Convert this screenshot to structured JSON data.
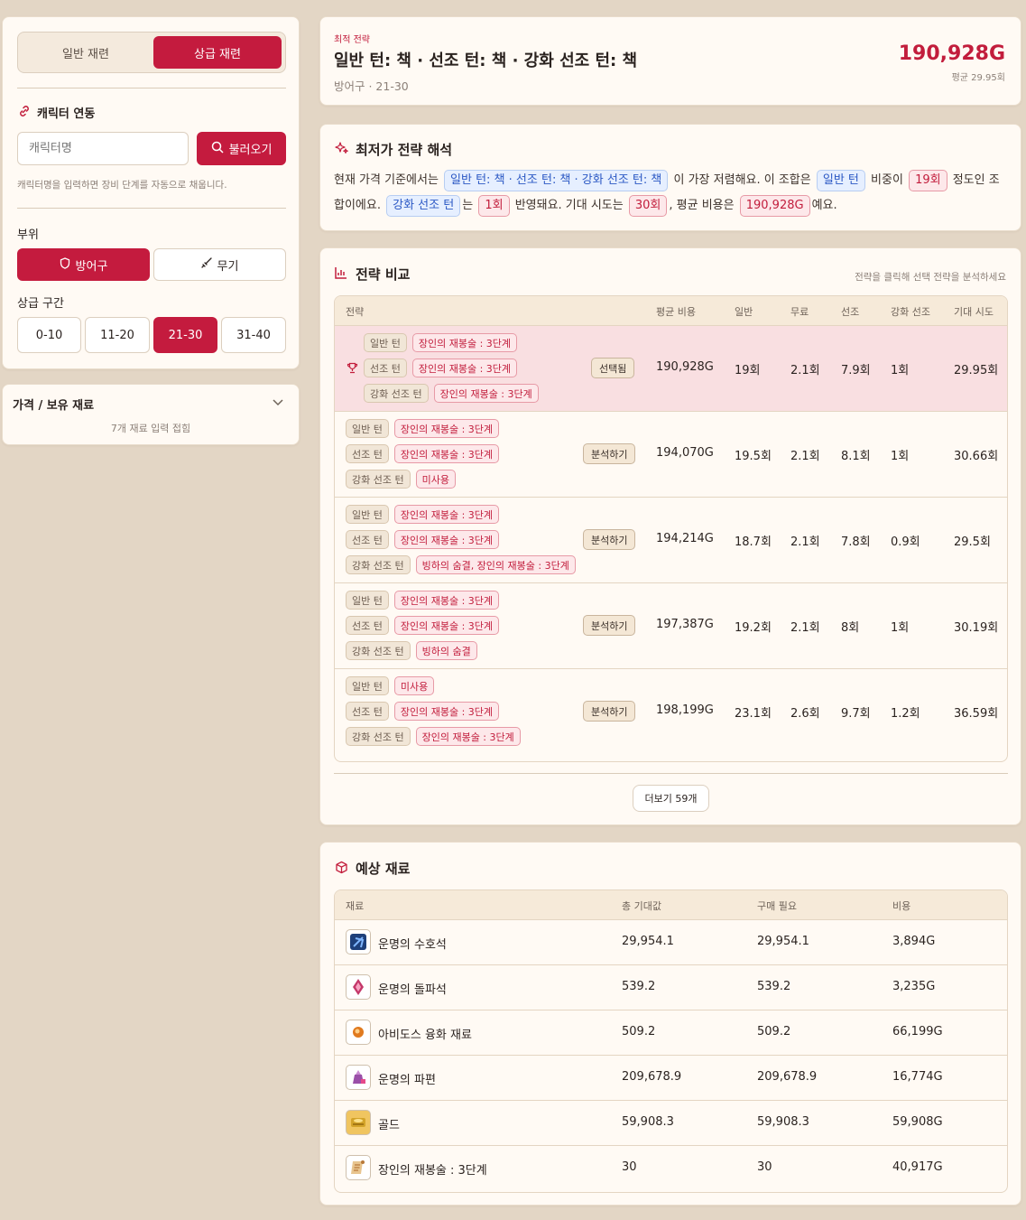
{
  "sidebar": {
    "tabs": [
      "일반 재련",
      "상급 재련"
    ],
    "character_title": "캐릭터 연동",
    "character_placeholder": "캐릭터명",
    "load_button": "불러오기",
    "character_help": "캐릭터명을 입력하면 장비 단계를 자동으로 채웁니다.",
    "part_label": "부위",
    "part_armor": "방어구",
    "part_weapon": "무기",
    "range_label": "상급 구간",
    "ranges": [
      "0-10",
      "11-20",
      "21-30",
      "31-40"
    ],
    "price_title": "가격 / 보유 재료",
    "price_sub": "7개 재료 입력 접힘"
  },
  "summary": {
    "eyebrow": "최적 전략",
    "title": "일반 턴: 책 · 선조 턴: 책 · 강화 선조 턴: 책",
    "sub": "방어구 · 21-30",
    "price": "190,928G",
    "avg": "평균 29.95회"
  },
  "analysis": {
    "title": "최저가 전략 해석",
    "t1": "현재 가격 기준에서는",
    "h1": "일반 턴: 책 · 선조 턴: 책 · 강화 선조 턴: 책",
    "t2": "이 가장 저렴해요. 이 조합은",
    "h2": "일반 턴",
    "t3": "비중이",
    "h3": "19회",
    "t4": "정도인 조합이에요.",
    "h4": "강화 선조 턴",
    "t5": "는",
    "h5": "1회",
    "t6": "반영돼요. 기대 시도는",
    "h6": "30회",
    "t7": ", 평균 비용은",
    "h7": "190,928G",
    "t8": "예요."
  },
  "compare": {
    "title": "전략 비교",
    "hint": "전략을 클릭해 선택 전략을 분석하세요",
    "headers": [
      "전략",
      "평균 비용",
      "일반",
      "무료",
      "선조",
      "강화 선조",
      "기대 시도"
    ],
    "turn_labels": [
      "일반 턴",
      "선조 턴",
      "강화 선조 턴"
    ],
    "rows": [
      {
        "tags": [
          "장인의 재봉술 : 3단계",
          "장인의 재봉술 : 3단계",
          "장인의 재봉술 : 3단계"
        ],
        "action": "선택됨",
        "cost": "190,928G",
        "normal": "19회",
        "free": "2.1회",
        "ancestor": "7.9회",
        "enh": "1회",
        "expected": "29.95회"
      },
      {
        "tags": [
          "장인의 재봉술 : 3단계",
          "장인의 재봉술 : 3단계",
          "미사용"
        ],
        "action": "분석하기",
        "cost": "194,070G",
        "normal": "19.5회",
        "free": "2.1회",
        "ancestor": "8.1회",
        "enh": "1회",
        "expected": "30.66회"
      },
      {
        "tags": [
          "장인의 재봉술 : 3단계",
          "장인의 재봉술 : 3단계",
          "빙하의 숨결, 장인의 재봉술 : 3단계"
        ],
        "action": "분석하기",
        "cost": "194,214G",
        "normal": "18.7회",
        "free": "2.1회",
        "ancestor": "7.8회",
        "enh": "0.9회",
        "expected": "29.5회"
      },
      {
        "tags": [
          "장인의 재봉술 : 3단계",
          "장인의 재봉술 : 3단계",
          "빙하의 숨결"
        ],
        "action": "분석하기",
        "cost": "197,387G",
        "normal": "19.2회",
        "free": "2.1회",
        "ancestor": "8회",
        "enh": "1회",
        "expected": "30.19회"
      },
      {
        "tags": [
          "미사용",
          "장인의 재봉술 : 3단계",
          "장인의 재봉술 : 3단계"
        ],
        "action": "분석하기",
        "cost": "198,199G",
        "normal": "23.1회",
        "free": "2.6회",
        "ancestor": "9.7회",
        "enh": "1.2회",
        "expected": "36.59회"
      }
    ],
    "more": "더보기 59개"
  },
  "materials": {
    "title": "예상 재료",
    "headers": [
      "재료",
      "총 기대값",
      "구매 필요",
      "비용"
    ],
    "rows": [
      {
        "icon": "guardian-stone-icon",
        "color": "#3a6fc9",
        "name": "운명의 수호석",
        "total": "29,954.1",
        "buy": "29,954.1",
        "cost": "3,894G"
      },
      {
        "icon": "breakthrough-stone-icon",
        "color": "#c4386a",
        "name": "운명의 돌파석",
        "total": "539.2",
        "buy": "539.2",
        "cost": "3,235G"
      },
      {
        "icon": "abidos-fusion-icon",
        "color": "#e07a1f",
        "name": "아비도스 융화 재료",
        "total": "509.2",
        "buy": "509.2",
        "cost": "66,199G"
      },
      {
        "icon": "fate-shard-icon",
        "color": "#9a4fa8",
        "name": "운명의 파편",
        "total": "209,678.9",
        "buy": "209,678.9",
        "cost": "16,774G"
      },
      {
        "icon": "gold-icon",
        "color": "#d3a329",
        "name": "골드",
        "total": "59,908.3",
        "buy": "59,908.3",
        "cost": "59,908G"
      },
      {
        "icon": "tailoring-scroll-icon",
        "color": "#b8793a",
        "name": "장인의 재봉술 : 3단계",
        "total": "30",
        "buy": "30",
        "cost": "40,917G"
      }
    ]
  }
}
